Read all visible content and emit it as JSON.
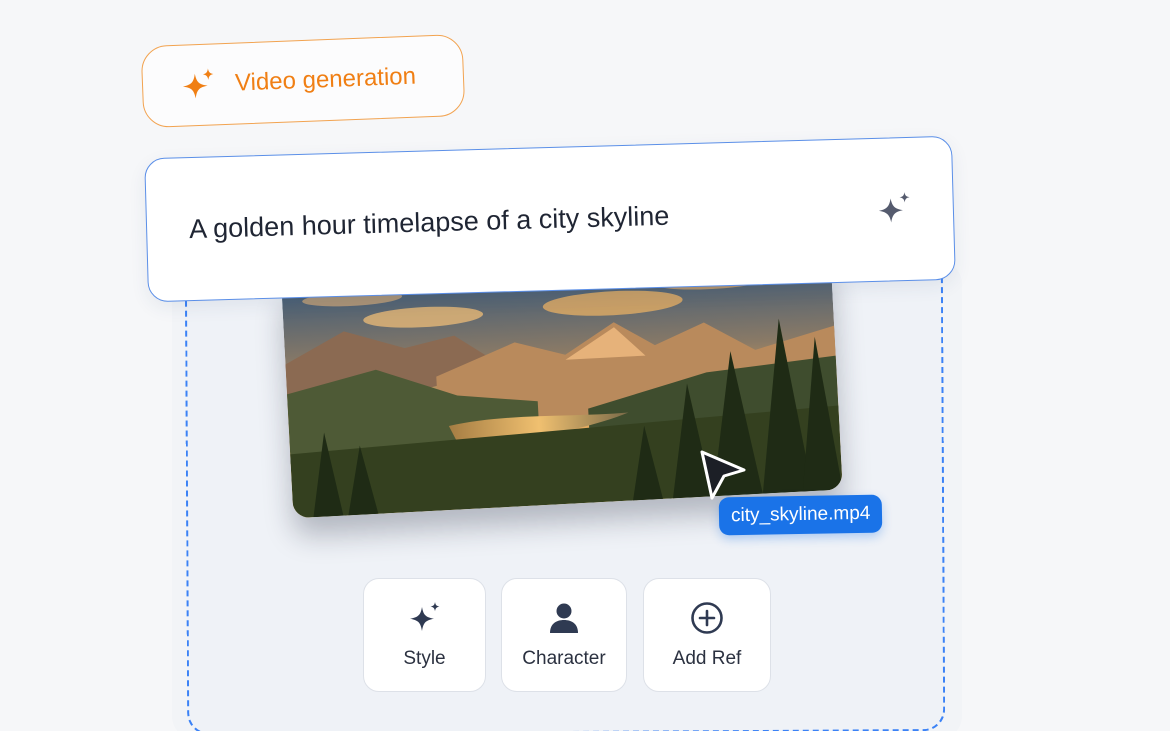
{
  "badge": {
    "label": "Video generation",
    "icon": "sparkle-icon",
    "color": "#f07f14"
  },
  "prompt": {
    "text": "A golden hour timelapse of a city skyline",
    "icon": "sparkle-icon"
  },
  "preview": {
    "filename": "city_skyline.mp4",
    "image": "mountain-lake-sunset"
  },
  "tools": [
    {
      "label": "Style",
      "icon": "sparkle-icon"
    },
    {
      "label": "Character",
      "icon": "person-icon"
    },
    {
      "label": "Add Ref",
      "icon": "plus-circle-icon"
    }
  ],
  "colors": {
    "accent": "#1a73e8",
    "orange": "#f07f14",
    "dash": "#3b82f6"
  }
}
